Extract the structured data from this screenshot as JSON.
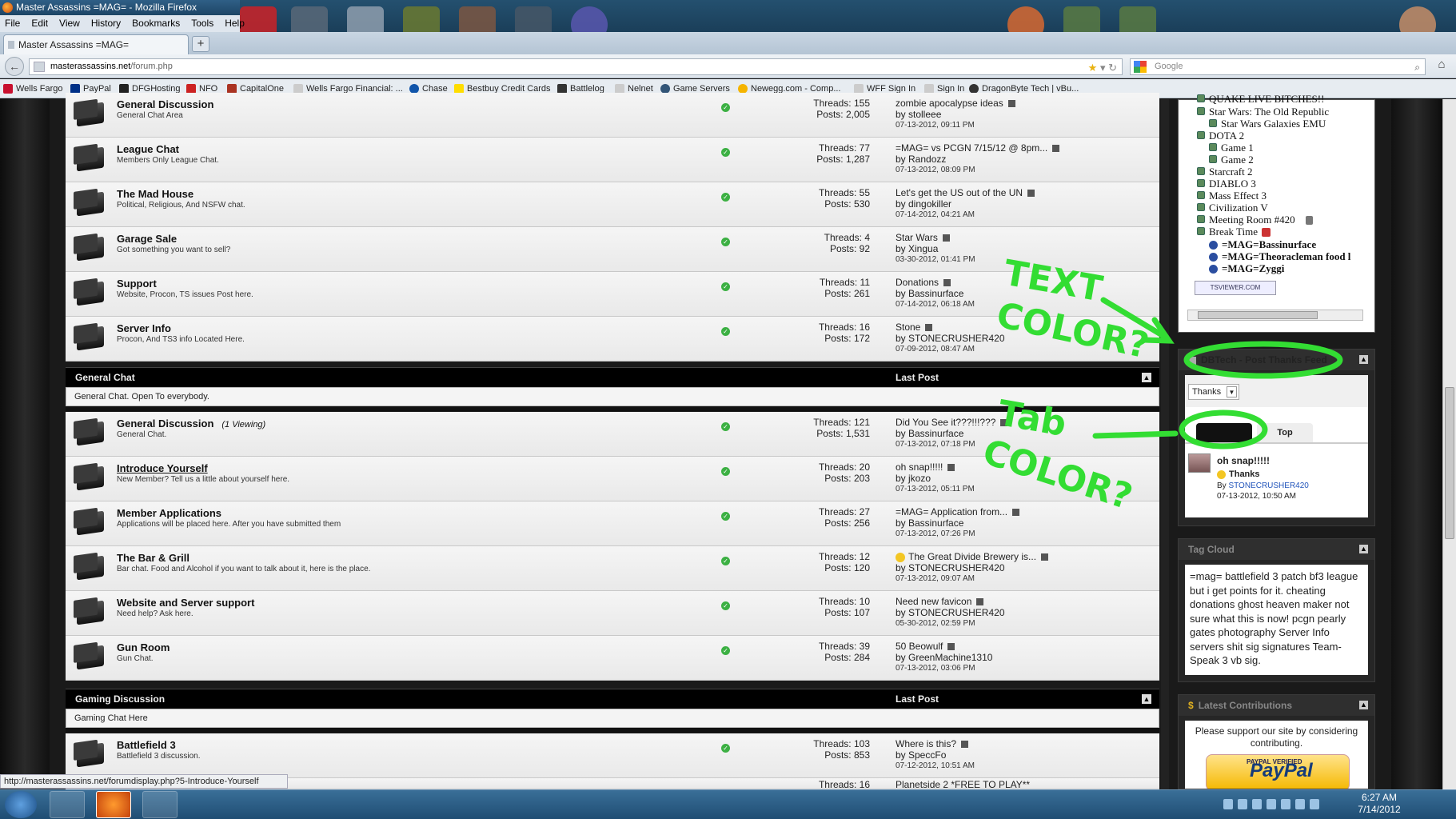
{
  "window": {
    "title": "Master Assassins =MAG= - Mozilla Firefox"
  },
  "menu": [
    "File",
    "Edit",
    "View",
    "History",
    "Bookmarks",
    "Tools",
    "Help"
  ],
  "tab": {
    "label": "Master Assassins =MAG=",
    "new_tab": "+"
  },
  "nav": {
    "url_host": "masterassassins.net",
    "url_path": "/forum.php",
    "search_placeholder": "Google"
  },
  "bookmarks": [
    {
      "label": "Wells Fargo",
      "color": "#c8102e"
    },
    {
      "label": "PayPal",
      "color": "#003087"
    },
    {
      "label": "DFGHosting",
      "color": "#222222"
    },
    {
      "label": "NFO",
      "color": "#cc2222"
    },
    {
      "label": "CapitalOne",
      "color": "#aa3322"
    },
    {
      "label": "Wells Fargo Financial: ...",
      "color": "#bbbbbb"
    },
    {
      "label": "Chase",
      "color": "#1155aa"
    },
    {
      "label": "Bestbuy Credit Cards",
      "color": "#ffdd00"
    },
    {
      "label": "Battlelog",
      "color": "#333333"
    },
    {
      "label": "Nelnet",
      "color": "#bbbbbb"
    },
    {
      "label": "Game Servers",
      "color": "#335577"
    },
    {
      "label": "Newegg.com - Comp...",
      "color": "#f5b400"
    },
    {
      "label": "WFF Sign In",
      "color": "#bbbbbb"
    },
    {
      "label": "Sign In",
      "color": "#bbbbbb"
    },
    {
      "label": "DragonByte Tech | vBu...",
      "color": "#333333"
    }
  ],
  "forums_top": [
    {
      "title": "General Discussion",
      "desc": "General Chat Area",
      "threads": "Threads: 155",
      "posts": "Posts: 2,005",
      "last": "zombie apocalypse ideas",
      "by": "by stolleee",
      "date": "07-13-2012,",
      "time": "09:11 PM"
    },
    {
      "title": "League Chat",
      "desc": "Members Only League Chat.",
      "threads": "Threads: 77",
      "posts": "Posts: 1,287",
      "last": "=MAG= vs PCGN 7/15/12 @ 8pm...",
      "by": "by Randozz",
      "date": "07-13-2012,",
      "time": "08:09 PM"
    },
    {
      "title": "The Mad House",
      "desc": "Political, Religious, And NSFW chat.",
      "threads": "Threads: 55",
      "posts": "Posts: 530",
      "last": "Let's get the US out of the UN",
      "by": "by dingokiller",
      "date": "07-14-2012,",
      "time": "04:21 AM"
    },
    {
      "title": "Garage Sale",
      "desc": "Got something you want to sell?",
      "threads": "Threads: 4",
      "posts": "Posts: 92",
      "last": "Star Wars",
      "by": "by Xingua",
      "date": "03-30-2012,",
      "time": "01:41 PM"
    },
    {
      "title": "Support",
      "desc": "Website, Procon, TS issues Post here.",
      "threads": "Threads: 11",
      "posts": "Posts: 261",
      "last": "Donations",
      "by": "by Bassinurface",
      "date": "07-14-2012,",
      "time": "06:18 AM"
    },
    {
      "title": "Server Info",
      "desc": "Procon, And TS3 info Located Here.",
      "threads": "Threads: 16",
      "posts": "Posts: 172",
      "last": "Stone",
      "by": "by STONECRUSHER420",
      "date": "07-09-2012,",
      "time": "08:47 AM"
    }
  ],
  "cat_general": {
    "title": "General Chat",
    "lastpost": "Last Post",
    "desc": "General Chat. Open To everybody."
  },
  "forums_general": [
    {
      "title": "General Discussion",
      "viewing": "(1 Viewing)",
      "desc": "General Chat.",
      "threads": "Threads: 121",
      "posts": "Posts: 1,531",
      "last": "Did You See it???!!!???",
      "by": "by Bassinurface",
      "date": "07-13-2012,",
      "time": "07:18 PM"
    },
    {
      "title": "Introduce Yourself",
      "viewing": "",
      "desc": "New Member? Tell us a little about yourself here.",
      "threads": "Threads: 20",
      "posts": "Posts: 203",
      "last": "oh snap!!!!!",
      "by": "by jkozo",
      "date": "07-13-2012,",
      "time": "05:11 PM"
    },
    {
      "title": "Member Applications",
      "viewing": "",
      "desc": "Applications will be placed here. After you have submitted them",
      "threads": "Threads: 27",
      "posts": "Posts: 256",
      "last": "=MAG= Application from...",
      "by": "by Bassinurface",
      "date": "07-13-2012,",
      "time": "07:26 PM"
    },
    {
      "title": "The Bar & Grill",
      "viewing": "",
      "desc": "Bar chat. Food and Alcohol if you want to talk about it, here is the place.",
      "threads": "Threads: 12",
      "posts": "Posts: 120",
      "last": "The Great Divide Brewery is...",
      "by": "by STONECRUSHER420",
      "date": "07-13-2012,",
      "time": "09:07 AM"
    },
    {
      "title": "Website and Server support",
      "viewing": "",
      "desc": "Need help? Ask here.",
      "threads": "Threads: 10",
      "posts": "Posts: 107",
      "last": "Need new favicon",
      "by": "by STONECRUSHER420",
      "date": "05-30-2012,",
      "time": "02:59 PM"
    },
    {
      "title": "Gun Room",
      "viewing": "",
      "desc": "Gun Chat.",
      "threads": "Threads: 39",
      "posts": "Posts: 284",
      "last": "50 Beowulf",
      "by": "by GreenMachine1310",
      "date": "07-13-2012,",
      "time": "03:06 PM"
    }
  ],
  "cat_gaming": {
    "title": "Gaming Discussion",
    "lastpost": "Last Post",
    "desc": "Gaming Chat Here"
  },
  "forums_gaming": [
    {
      "title": "Battlefield 3",
      "desc": "Battlefield 3 discussion.",
      "threads": "Threads: 103",
      "posts": "Posts: 853",
      "last": "Where is this?",
      "by": "by SpeccFo",
      "date": "07-12-2012,",
      "time": "10:51 AM"
    },
    {
      "title": "",
      "desc": "",
      "threads": "Threads: 16",
      "posts": "",
      "last": "Planetside 2 *FREE TO PLAY**",
      "by": "",
      "date": "",
      "time": ""
    }
  ],
  "teamspeak": {
    "lines": [
      "QUAKE LIVE BITCHES!!",
      "Star Wars: The Old Republic",
      "Star Wars Galaxies EMU",
      "DOTA 2",
      "Game 1",
      "Game 2",
      "Starcraft 2",
      "DIABLO 3",
      "Mass Effect 3",
      "Civilization V",
      "Meeting Room #420",
      "Break Time"
    ],
    "users": [
      "=MAG=Bassinurface",
      "=MAG=Theoracleman food l",
      "=MAG=Zyggi"
    ],
    "badge": "TSVIEWER.COM"
  },
  "thanks_feed": {
    "title": "DBTech - Post Thanks Feed",
    "select": "Thanks",
    "tab_top": "Top",
    "post_title": "oh snap!!!!!",
    "kind": "Thanks",
    "by_prefix": "By",
    "by_user": "STONECRUSHER420",
    "date": "07-13-2012, 10:50 AM"
  },
  "tag_cloud": {
    "title": "Tag Cloud",
    "text": "=mag= battlefield 3 patch bf3 league but i get points for it. cheating donations ghost heaven maker not sure what this is now! pcgn pearly gates photography Server Info servers shit sig signatures Team-Speak 3 vb sig."
  },
  "contrib": {
    "title": "Latest Contributions",
    "text": "Please support our site by considering contributing.",
    "paypal_verified": "PAYPAL VERIFIED",
    "paypal": "PayPal"
  },
  "annotations": {
    "text_color": [
      "TEXT",
      "COLOR?"
    ],
    "tab_color": [
      "Tab",
      "COLOR?"
    ],
    "color": "#33dd33"
  },
  "statusbar": "http://masterassassins.net/forumdisplay.php?5-Introduce-Yourself",
  "clock": {
    "time": "6:27 AM",
    "date": "7/14/2012"
  }
}
